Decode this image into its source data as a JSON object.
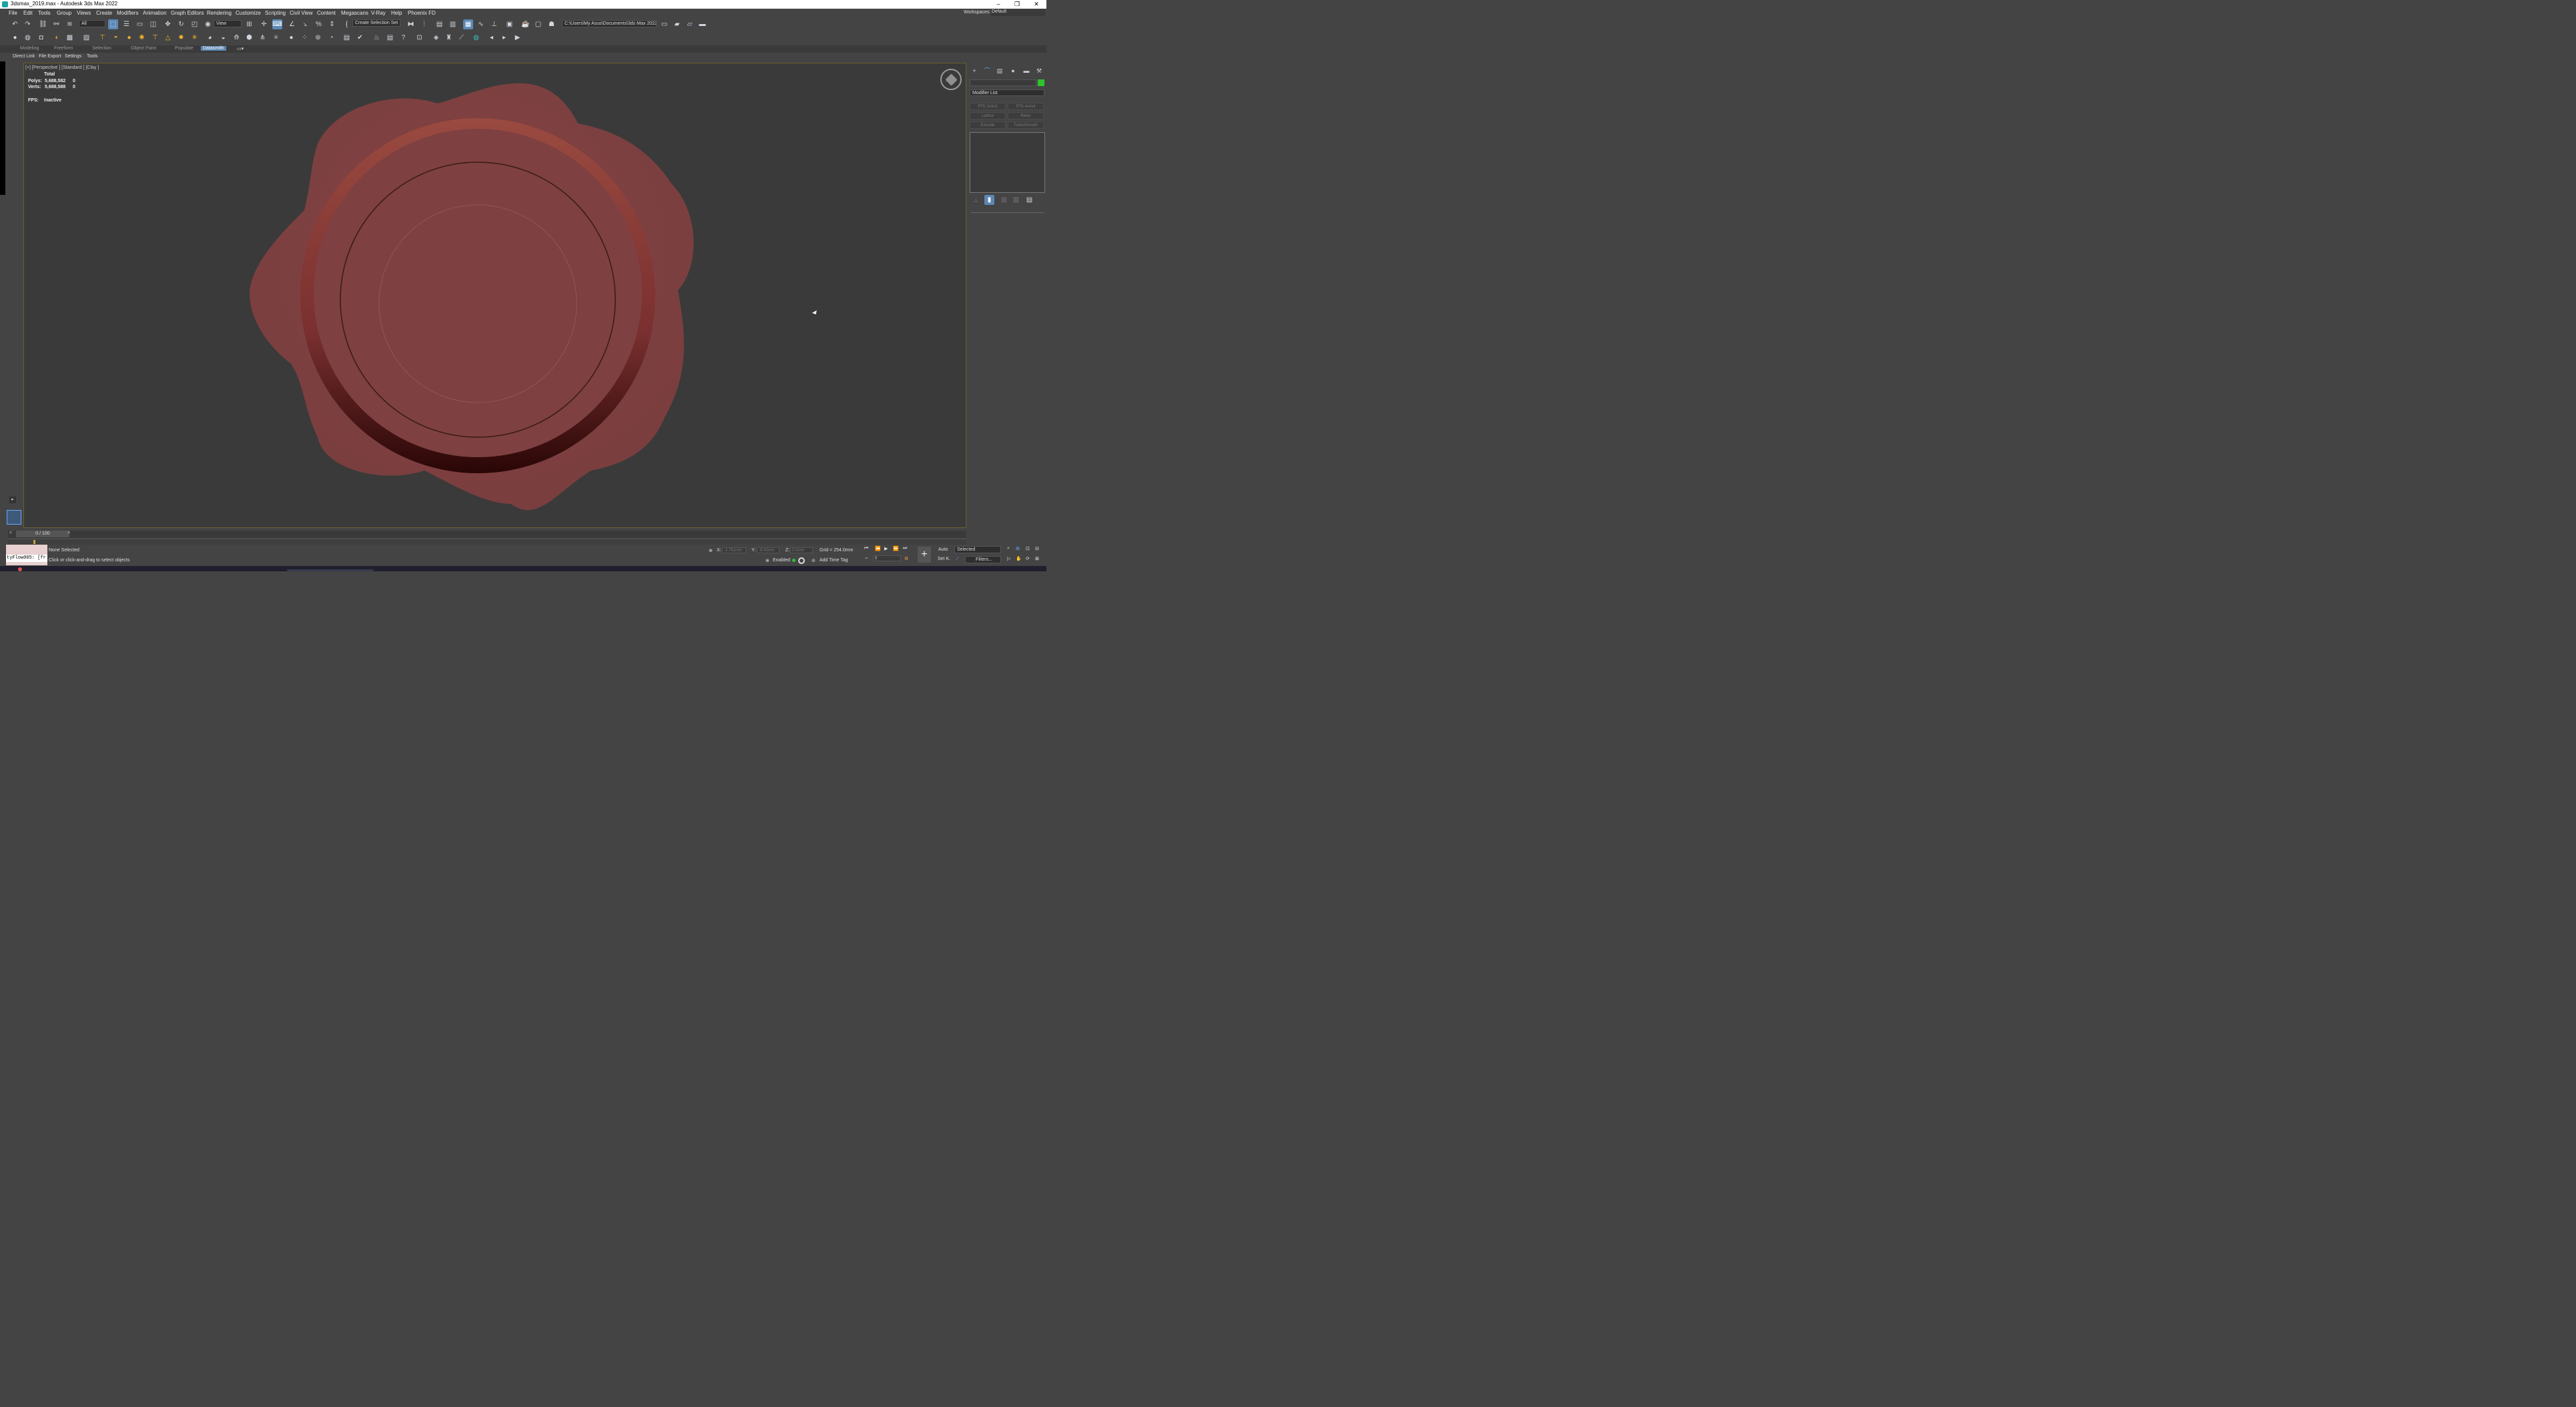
{
  "window": {
    "title": "3dsmax_2019.max - Autodesk 3ds Max 2022",
    "minimize": "–",
    "maximize": "❐",
    "close": "✕"
  },
  "menu": {
    "items": [
      "File",
      "Edit",
      "Tools",
      "Group",
      "Views",
      "Create",
      "Modifiers",
      "Animation",
      "Graph Editors",
      "Rendering",
      "Customize",
      "Scripting",
      "Civil View",
      "Content",
      "Megascans",
      "V-Ray",
      "Help",
      "Phoenix FD"
    ],
    "workspaces_label": "Workspaces:",
    "workspaces_value": "Default"
  },
  "toolbar": {
    "filter_select": "All",
    "refcoord_select": "View",
    "selection_set": "Create Selection Set",
    "path": "C:\\Users\\My Asus\\Documents\\3ds Max 2022"
  },
  "ribbon": {
    "tabs": [
      "Modeling",
      "Freeform",
      "Selection",
      "Object Paint",
      "Populate",
      "Datasmith"
    ],
    "active_tab": "Datasmith",
    "sub_items": [
      "Direct Link",
      "File Export",
      "Settings",
      "Tools"
    ]
  },
  "viewport": {
    "label": "[+] [Perspective ] [Standard ] [Clay ]",
    "stats_total": "Total",
    "polys_label": "Polys:",
    "polys_value": "5,688,582",
    "polys_sel": "0",
    "verts_label": "Verts:",
    "verts_value": "5,688,588",
    "verts_sel": "0",
    "fps_label": "FPS:",
    "fps_value": "Inactive",
    "seal_color": "#7e4040"
  },
  "command_panel": {
    "modifier_list": "Modifier List",
    "buttons": [
      "FFD 3x3x3",
      "FFD 4x4x4",
      "Lattice",
      "Relax",
      "Extrude",
      "TurboSmooth"
    ],
    "color_swatch": "#2ec42e"
  },
  "timeline": {
    "frame": "0 / 100"
  },
  "status": {
    "script_text": "tyFlow005: [fr",
    "selection": "None Selected",
    "prompt": "Click or click-and-drag to select objects",
    "x_label": "X:",
    "x_value": "-2.761mm",
    "y_label": "Y:",
    "y_value": "-8.43mm",
    "z_label": "Z:",
    "z_value": "0.0mm",
    "grid": "Grid = 254.0mm",
    "enabled": "Enabled:",
    "add_time_tag": "Add Time Tag",
    "auto": "Auto",
    "set_k": "Set K.",
    "selected": "Selected",
    "filters": "Filters...",
    "frame_field": "0"
  }
}
